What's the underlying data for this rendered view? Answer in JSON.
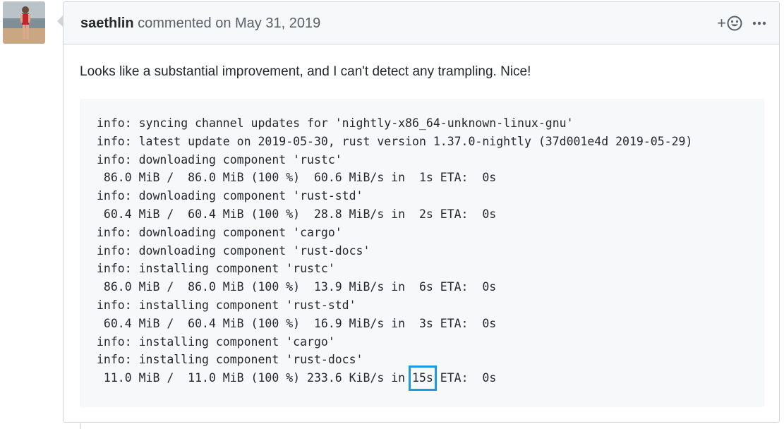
{
  "comment": {
    "author": "saethlin",
    "action": "commented on",
    "date": "May 31, 2019",
    "body_text": "Looks like a substantial improvement, and I can't detect any trampling. Nice!",
    "reaction_plus": "+",
    "code_lines": [
      "info: syncing channel updates for 'nightly-x86_64-unknown-linux-gnu'",
      "info: latest update on 2019-05-30, rust version 1.37.0-nightly (37d001e4d 2019-05-29)",
      "info: downloading component 'rustc'",
      " 86.0 MiB /  86.0 MiB (100 %)  60.6 MiB/s in  1s ETA:  0s",
      "info: downloading component 'rust-std'",
      " 60.4 MiB /  60.4 MiB (100 %)  28.8 MiB/s in  2s ETA:  0s",
      "info: downloading component 'cargo'",
      "info: downloading component 'rust-docs'",
      "info: installing component 'rustc'",
      " 86.0 MiB /  86.0 MiB (100 %)  13.9 MiB/s in  6s ETA:  0s",
      "info: installing component 'rust-std'",
      " 60.4 MiB /  60.4 MiB (100 %)  16.9 MiB/s in  3s ETA:  0s",
      "info: installing component 'cargo'",
      "info: installing component 'rust-docs'"
    ],
    "last_line": {
      "before": " 11.0 MiB /  11.0 MiB (100 %) 233.6 KiB/s in ",
      "highlighted": "15s",
      "after": " ETA:  0s"
    },
    "highlight_color": "#1d9be0"
  }
}
